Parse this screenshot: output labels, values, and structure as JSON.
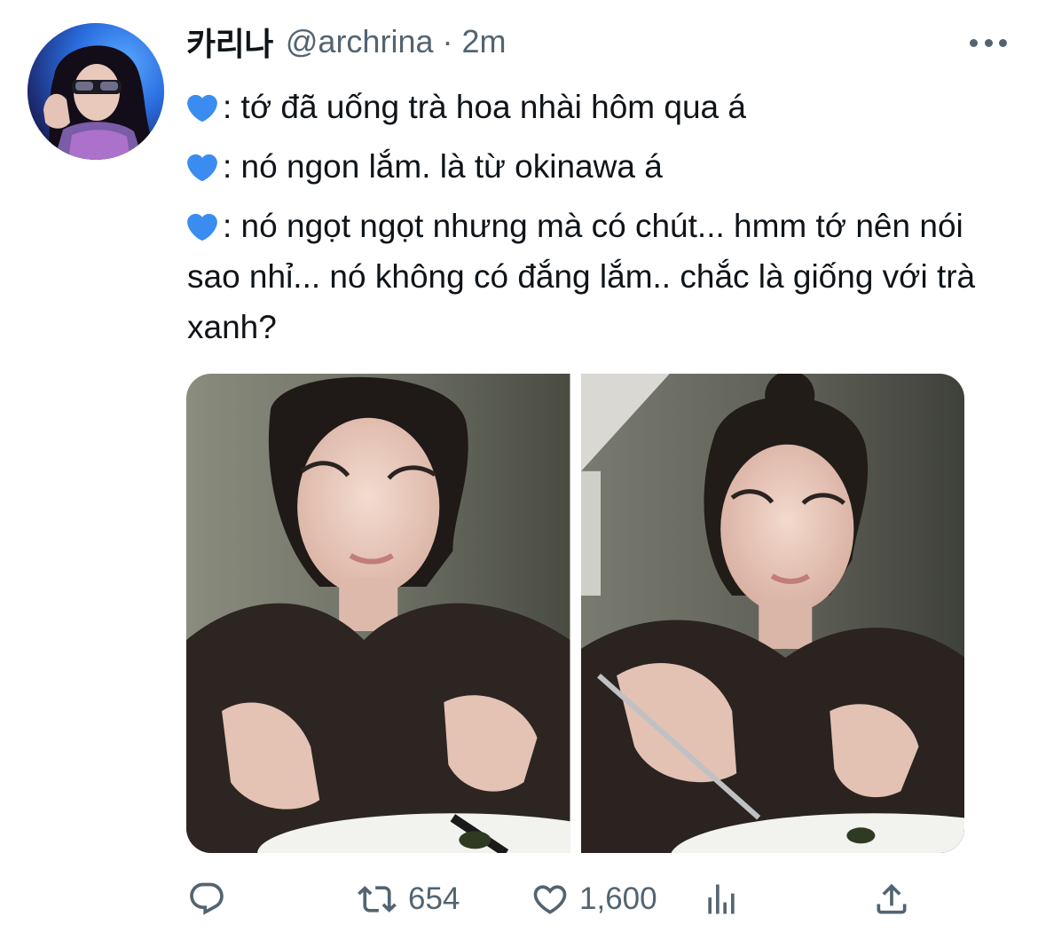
{
  "tweet": {
    "display_name": "카리나",
    "handle": "@archrina",
    "separator": "·",
    "time": "2m",
    "lines": [
      ": tớ đã uống trà hoa nhài hôm qua á",
      ": nó ngon lắm. là từ okinawa á",
      ": nó ngọt ngọt nhưng mà có chút... hmm tớ nên nói sao nhỉ... nó không có đắng lắm.. chắc là giống với trà xanh?"
    ],
    "line_emoji": "blue-heart-icon",
    "media": [
      {
        "name": "photo-1"
      },
      {
        "name": "photo-2"
      }
    ]
  },
  "actions": {
    "reply_icon": "reply-icon",
    "retweet_icon": "retweet-icon",
    "retweet_count": "654",
    "like_icon": "like-icon",
    "like_count": "1,600",
    "analytics_icon": "analytics-icon",
    "share_icon": "share-icon"
  },
  "colors": {
    "text": "#0f1419",
    "secondary": "#536471",
    "heart": "#3b8cf0"
  }
}
